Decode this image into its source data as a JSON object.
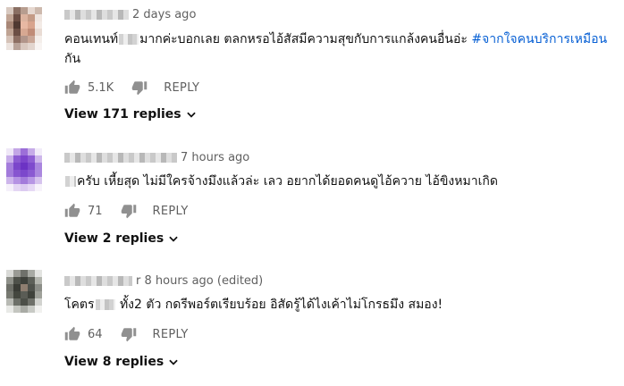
{
  "comments": [
    {
      "author": "",
      "time": "2 days ago",
      "text_before": "คอนเทนท์",
      "text_after": "มากค่ะบอกเลย ตลกหรอไอ้สัสมีความสุขกับการแกล้งคนอื่นอ่ะ ",
      "hashtag": "#จากใจคนบริการเหมือน",
      "text_wrap": "กัน",
      "likes": "5.1K",
      "reply_label": "REPLY",
      "view_replies": "View 171 replies"
    },
    {
      "author": "",
      "time": "7 hours ago",
      "text_before": "",
      "text_after": "ครับ เหี้ยสุด ไม่มีใครจ้างมึงแล้วล่ะ เลว อยากได้ยอดคนดูไอ้ควาย ไอ้ขิงหมาเกิด",
      "likes": "71",
      "reply_label": "REPLY",
      "view_replies": "View 2 replies"
    },
    {
      "author": "r",
      "time": "8 hours ago (edited)",
      "text_before": "โคตร",
      "text_after": " ทั้ง2 ตัว กดรีพอร์ตเรียบร้อย อิสัดรู้ได้ไงเค้าไม่โกรธมึง สมอง!",
      "likes": "64",
      "reply_label": "REPLY",
      "view_replies": "View 8 replies"
    }
  ],
  "icons": [
    "thumb-up-icon",
    "thumb-down-icon",
    "chevron-down-icon"
  ],
  "colors": {
    "link": "#065fd4",
    "meta": "#606060",
    "text": "#111111"
  }
}
